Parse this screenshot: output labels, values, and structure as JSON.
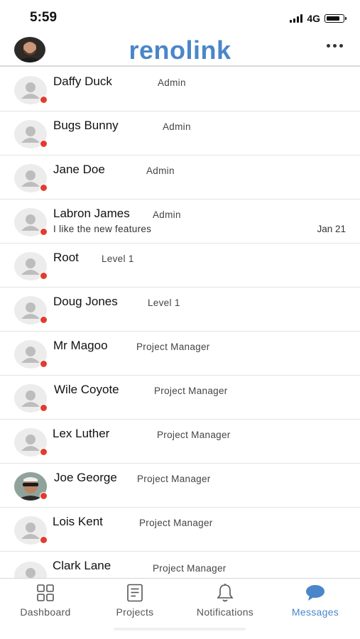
{
  "status": {
    "time": "5:59",
    "network": "4G"
  },
  "header": {
    "logo": "renolink",
    "avatar_icon": "user-photo",
    "more_icon": "more-dots-icon"
  },
  "contacts": [
    {
      "name": "Daffy Duck",
      "role": "Admin",
      "message": "",
      "date": ""
    },
    {
      "name": "Bugs Bunny",
      "role": "Admin",
      "message": "",
      "date": ""
    },
    {
      "name": "Jane Doe",
      "role": "Admin",
      "message": "",
      "date": ""
    },
    {
      "name": "Labron James",
      "role": "Admin",
      "message": "I like the new features",
      "date": "Jan 21"
    },
    {
      "name": "Root",
      "role": "Level 1",
      "message": "",
      "date": ""
    },
    {
      "name": "Doug Jones",
      "role": "Level 1",
      "message": "",
      "date": ""
    },
    {
      "name": "Mr Magoo",
      "role": "Project Manager",
      "message": "",
      "date": ""
    },
    {
      "name": "Wile Coyote",
      "role": "Project Manager",
      "message": "",
      "date": ""
    },
    {
      "name": "Lex Luther",
      "role": "Project Manager",
      "message": "",
      "date": ""
    },
    {
      "name": "Joe George",
      "role": "Project Manager",
      "message": "",
      "date": ""
    },
    {
      "name": "Lois Kent",
      "role": "Project Manager",
      "message": "",
      "date": ""
    },
    {
      "name": "Clark Lane",
      "role": "Project Manager",
      "message": "",
      "date": ""
    }
  ],
  "tabs": [
    {
      "label": "Dashboard",
      "icon": "grid-icon"
    },
    {
      "label": "Projects",
      "icon": "document-icon"
    },
    {
      "label": "Notifications",
      "icon": "bell-icon"
    },
    {
      "label": "Messages",
      "icon": "chat-bubble-icon",
      "active": true
    }
  ],
  "colors": {
    "accent": "#4a86c9",
    "status_dot": "#e23b2f"
  }
}
